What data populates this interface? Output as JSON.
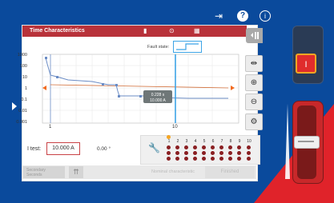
{
  "window": {
    "title": "Time Characteristics"
  },
  "fault_state": {
    "label": "Fault state:"
  },
  "plot": {
    "y_ticks": [
      "1000",
      "100",
      "10",
      "1",
      "0.1",
      "0.01",
      "0.001"
    ],
    "x_ticks": [
      "1",
      "10"
    ],
    "tooltip_time": "0.228 s",
    "tooltip_current": "10.000 A"
  },
  "tools": [
    "fit-width",
    "zoom-in",
    "zoom-out",
    "settings"
  ],
  "test": {
    "label": "I test:",
    "value": "10.000 A",
    "angle": "0.00 °"
  },
  "binary": {
    "numbers": [
      "1",
      "2",
      "3",
      "4",
      "5",
      "6",
      "7",
      "8",
      "9",
      "10"
    ]
  },
  "nav": {
    "secondary": "Secondary\nSeconds",
    "nominal": "Nominal characteristic",
    "finished": "Finished"
  },
  "colors": {
    "accent_red": "#b8323a",
    "marker_orange": "#f26a1f",
    "cursor_blue": "#3da4e6",
    "background_blue": "#0a4a9c"
  }
}
